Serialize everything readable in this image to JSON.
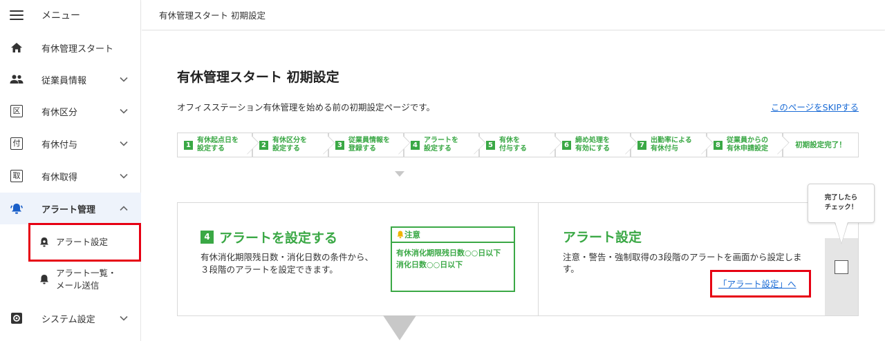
{
  "sidebar": {
    "menu_label": "メニュー",
    "items": [
      {
        "label": "有休管理スタート",
        "icon": "home-icon"
      },
      {
        "label": "従業員情報",
        "icon": "people-icon"
      },
      {
        "label": "有休区分",
        "icon": "ku-icon",
        "glyph": "区"
      },
      {
        "label": "有休付与",
        "icon": "fu-icon",
        "glyph": "付"
      },
      {
        "label": "有休取得",
        "icon": "shu-icon",
        "glyph": "取"
      },
      {
        "label": "アラート管理",
        "icon": "alarm-icon"
      },
      {
        "label": "システム設定",
        "icon": "gear-icon"
      }
    ],
    "sub_items": [
      {
        "label": "アラート設定",
        "icon": "bell-gear-icon"
      },
      {
        "label_line1": "アラート一覧・",
        "label_line2": "メール送信",
        "icon": "bell-icon"
      }
    ]
  },
  "topbar": {
    "title": "有休管理スタート 初期設定"
  },
  "main": {
    "title": "有休管理スタート 初期設定",
    "description": "オフィスステーション有休管理を始める前の初期設定ページです。",
    "skip_link": "このページをSKIPする",
    "steps": [
      {
        "num": "1",
        "line1": "有休起点日を",
        "line2": "設定する"
      },
      {
        "num": "2",
        "line1": "有休区分を",
        "line2": "設定する"
      },
      {
        "num": "3",
        "line1": "従業員情報を",
        "line2": "登録する"
      },
      {
        "num": "4",
        "line1": "アラートを",
        "line2": "設定する"
      },
      {
        "num": "5",
        "line1": "有休を",
        "line2": "付与する"
      },
      {
        "num": "6",
        "line1": "締め処理を",
        "line2": "有効にする"
      },
      {
        "num": "7",
        "line1": "出勤率による",
        "line2": "有休付与"
      },
      {
        "num": "8",
        "line1": "従業員からの",
        "line2": "有休申請設定"
      }
    ],
    "final_step": "初期設定完了！",
    "card": {
      "num": "4",
      "title": "アラートを設定する",
      "text": "有休消化期限残日数・消化日数の条件から、３段階のアラートを設定できます。",
      "notice_title": "注意",
      "notice_line1": "有休消化期限残日数○○日以下",
      "notice_line2": "消化日数○○日以下",
      "right_title": "アラート設定",
      "right_text": "注意・警告・強制取得の3段階のアラートを画面から設定します。",
      "right_link": "「アラート設定」へ"
    },
    "bubble_line1": "完了したら",
    "bubble_line2": "チェック！"
  },
  "colors": {
    "accent_green": "#3aa845",
    "link_blue": "#1a6bd6",
    "highlight_red": "#e60012",
    "active_bg": "#eef3fb"
  }
}
